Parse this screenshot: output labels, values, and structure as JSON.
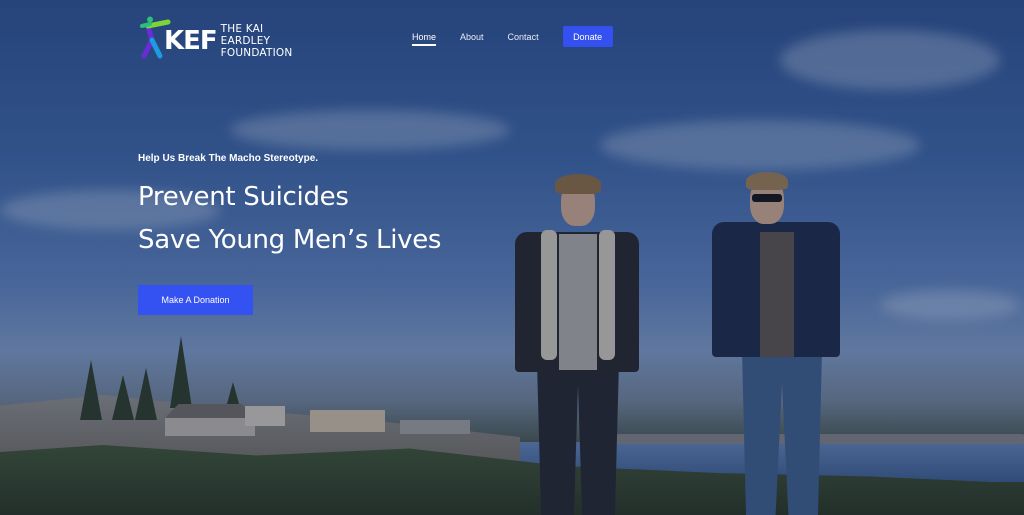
{
  "logo": {
    "abbr": "KEF",
    "line1": "THE KAI EARDLEY",
    "line2": "FOUNDATION"
  },
  "nav": {
    "items": [
      {
        "label": "Home",
        "active": true
      },
      {
        "label": "About",
        "active": false
      },
      {
        "label": "Contact",
        "active": false
      }
    ],
    "donate_label": "Donate"
  },
  "hero": {
    "tagline": "Help Us Break The Macho Stereotype.",
    "headline_line1": "Prevent Suicides",
    "headline_line2": "Save Young Men’s Lives",
    "cta_label": "Make A Donation"
  },
  "colors": {
    "accent": "#3451f2",
    "text": "#ffffff"
  }
}
